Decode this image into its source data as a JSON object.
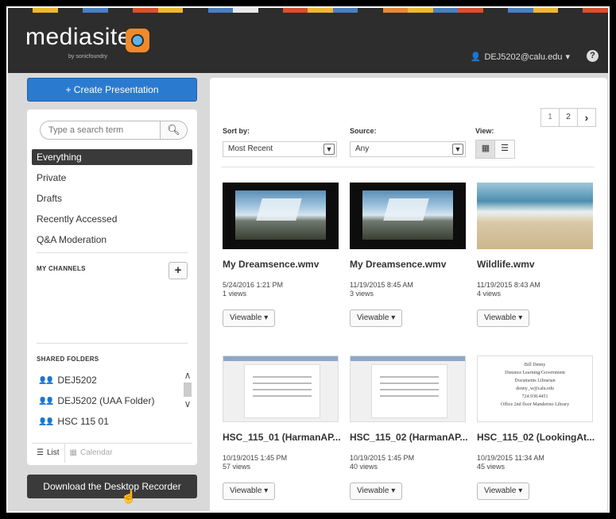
{
  "app": {
    "logo_text": "mediasite",
    "logo_by": "by sonicfoundry",
    "user": "DEJ5202@calu.edu",
    "help": "?",
    "stripe_colors": [
      "#2d2d2d",
      "#f2b630",
      "#2d2d2d",
      "#4a7ec4",
      "#2d2d2d",
      "#d9502b",
      "#f2b630",
      "#2d2d2d",
      "#4a7ec4",
      "#e8e8e8",
      "#2d2d2d",
      "#d9502b",
      "#f2b630",
      "#4a7ec4",
      "#2d2d2d",
      "#e88930",
      "#f2b630",
      "#4a7ec4",
      "#d9502b",
      "#2d2d2d",
      "#4a7ec4",
      "#f2b630",
      "#2d2d2d",
      "#d9502b"
    ]
  },
  "sidebar": {
    "create_button": "+ Create Presentation",
    "search_placeholder": "Type a search term",
    "search_icon": "search-icon",
    "nav": [
      {
        "label": "Everything",
        "active": true
      },
      {
        "label": "Private",
        "active": false
      },
      {
        "label": "Drafts",
        "active": false
      },
      {
        "label": "Recently Accessed",
        "active": false
      },
      {
        "label": "Q&A Moderation",
        "active": false
      }
    ],
    "my_channels_label": "MY CHANNELS",
    "add_channel": "+",
    "shared_folders_label": "SHARED FOLDERS",
    "folders": [
      "DEJ5202",
      "DEJ5202 (UAA Folder)",
      "HSC 115 01"
    ],
    "tabs": {
      "list": "List",
      "calendar": "Calendar"
    },
    "download_button": "Download the Desktop Recorder"
  },
  "controls": {
    "sort_label": "Sort by:",
    "sort_value": "Most Recent",
    "source_label": "Source:",
    "source_value": "Any",
    "view_label": "View:",
    "pages": [
      "1",
      "2"
    ],
    "next": "›"
  },
  "presentations": [
    {
      "title": "My Dreamsence.wmv",
      "date": "5/24/2016 1:21 PM",
      "views": "1 views",
      "status": "Viewable",
      "thumb": "dream"
    },
    {
      "title": "My Dreamsence.wmv",
      "date": "11/19/2015 8:45 AM",
      "views": "3 views",
      "status": "Viewable",
      "thumb": "dream"
    },
    {
      "title": "Wildlife.wmv",
      "date": "11/19/2015 8:43 AM",
      "views": "4 views",
      "status": "Viewable",
      "thumb": "wild"
    },
    {
      "title": "HSC_115_01 (HarmanAP...",
      "date": "10/19/2015 1:45 PM",
      "views": "57 views",
      "status": "Viewable",
      "thumb": "doc"
    },
    {
      "title": "HSC_115_02 (HarmanAP...",
      "date": "10/19/2015 1:45 PM",
      "views": "40 views",
      "status": "Viewable",
      "thumb": "doc"
    },
    {
      "title": "HSC_115_02 (LookingAt...",
      "date": "10/19/2015 11:34 AM",
      "views": "45 views",
      "status": "Viewable",
      "thumb": "plain"
    }
  ],
  "plain_thumb_lines": [
    "Bill Denny",
    "Distance Learning/Government",
    "Documents Librarian",
    "denny_w@calu.edu",
    "724.938.4451",
    "Office 2nd floor Manderino Library"
  ]
}
